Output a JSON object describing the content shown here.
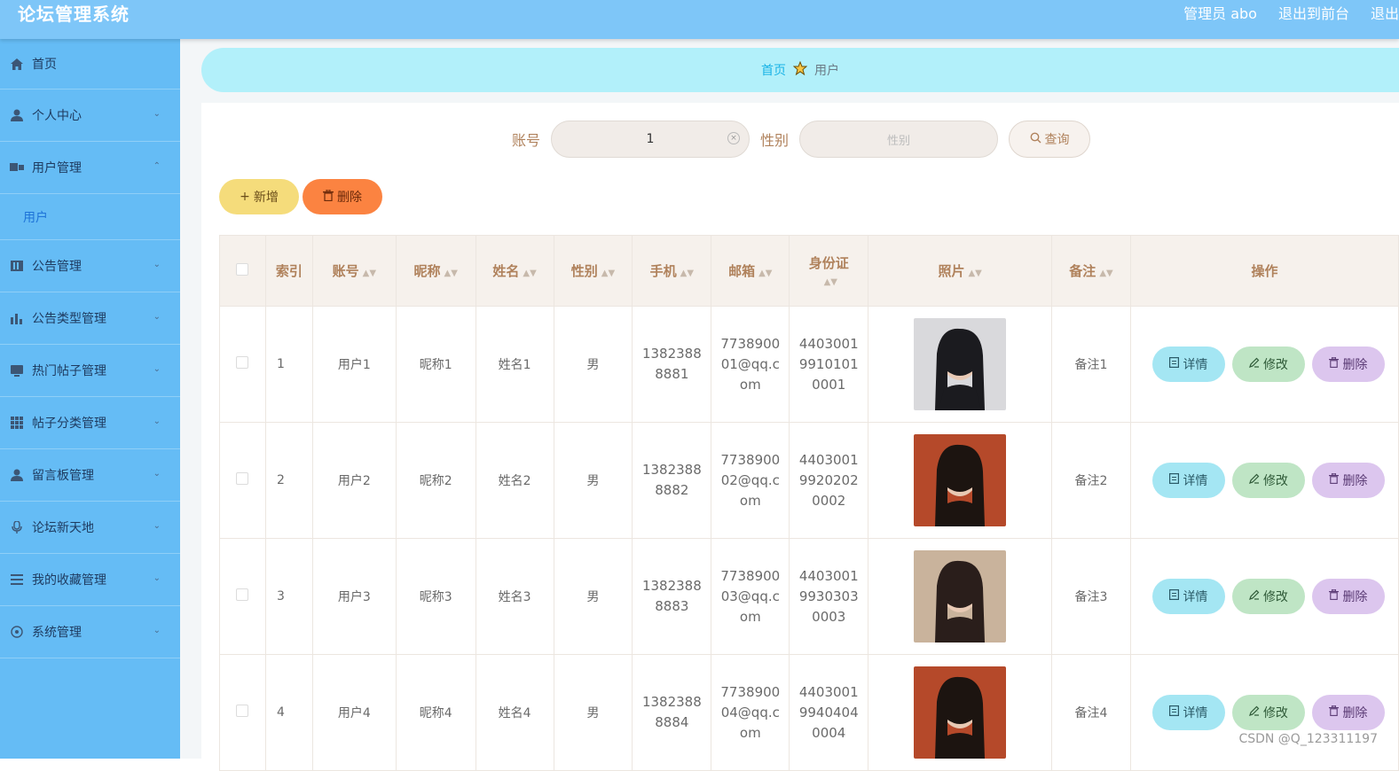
{
  "app": {
    "title": "论坛管理系统",
    "user": "管理员 abo",
    "frontend": "退出到前台",
    "logout": "退出"
  },
  "sidebar": {
    "items": [
      {
        "label": "首页",
        "icon": "home-icon"
      },
      {
        "label": "个人中心",
        "icon": "user-icon"
      },
      {
        "label": "用户管理",
        "icon": "users-icon"
      },
      {
        "label": "公告管理",
        "icon": "notice-icon"
      },
      {
        "label": "公告类型管理",
        "icon": "bar-chart-icon"
      },
      {
        "label": "热门帖子管理",
        "icon": "hot-post-icon"
      },
      {
        "label": "帖子分类管理",
        "icon": "grid-icon"
      },
      {
        "label": "留言板管理",
        "icon": "message-icon"
      },
      {
        "label": "论坛新天地",
        "icon": "mic-icon"
      },
      {
        "label": "我的收藏管理",
        "icon": "list-icon"
      },
      {
        "label": "系统管理",
        "icon": "settings-icon"
      }
    ],
    "sub_item": "用户"
  },
  "breadcrumb": {
    "home": "首页",
    "current": "用户"
  },
  "search": {
    "account_label": "账号",
    "account_value": "1",
    "gender_label": "性别",
    "gender_placeholder": "性别",
    "query_label": "查询"
  },
  "actions": {
    "add": "新增",
    "delete": "删除"
  },
  "table": {
    "headers": {
      "index": "索引",
      "account": "账号",
      "nickname": "昵称",
      "name": "姓名",
      "gender": "性别",
      "phone": "手机",
      "email": "邮箱",
      "idcard": "身份证",
      "photo": "照片",
      "note": "备注",
      "ops": "操作"
    },
    "rows": [
      {
        "index": "1",
        "account": "用户1",
        "nickname": "昵称1",
        "name": "姓名1",
        "gender": "男",
        "phone": "13823888881",
        "email": "773890001@qq.com",
        "idcard": "440300199101010001",
        "note": "备注1"
      },
      {
        "index": "2",
        "account": "用户2",
        "nickname": "昵称2",
        "name": "姓名2",
        "gender": "男",
        "phone": "13823888882",
        "email": "773890002@qq.com",
        "idcard": "440300199202020002",
        "note": "备注2"
      },
      {
        "index": "3",
        "account": "用户3",
        "nickname": "昵称3",
        "name": "姓名3",
        "gender": "男",
        "phone": "13823888883",
        "email": "773890003@qq.com",
        "idcard": "440300199303030003",
        "note": "备注3"
      },
      {
        "index": "4",
        "account": "用户4",
        "nickname": "昵称4",
        "name": "姓名4",
        "gender": "男",
        "phone": "13823888884",
        "email": "773890004@qq.com",
        "idcard": "440300199404040004",
        "note": "备注4"
      }
    ],
    "op_detail": "详情",
    "op_edit": "修改",
    "op_delete": "删除"
  },
  "watermark": "CSDN @Q_123311197",
  "colors": {
    "topbar": "#7ec6f8",
    "sidebar": "#65bcf5",
    "breadcrumb_bg": "#b2f0fa",
    "add_button": "#f5dc7b",
    "delete_button": "#fb8341"
  }
}
